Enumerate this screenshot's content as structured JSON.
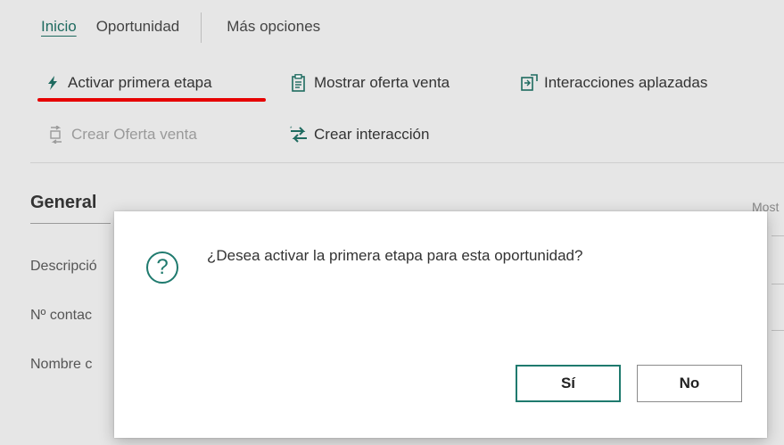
{
  "tabs": [
    {
      "label": "Inicio"
    },
    {
      "label": "Oportunidad"
    },
    {
      "label": "Más opciones"
    }
  ],
  "actions": {
    "activate_first_stage": "Activar primera etapa",
    "show_sales_quote": "Mostrar oferta venta",
    "postponed_interactions": "Interacciones aplazadas",
    "create_sales_quote": "Crear Oferta venta",
    "create_interaction": "Crear interacción"
  },
  "section": {
    "title": "General",
    "show_more": "Most"
  },
  "fields": [
    {
      "label": "Descripció"
    },
    {
      "label": "Nº contac"
    },
    {
      "label": "Nombre c"
    }
  ],
  "dialog": {
    "message": "¿Desea activar la primera etapa para esta oportunidad?",
    "yes_label": "Sí",
    "no_label": "No",
    "icon": "question-icon"
  },
  "colors": {
    "accent": "#1f7a6e",
    "highlight": "#e60000"
  }
}
